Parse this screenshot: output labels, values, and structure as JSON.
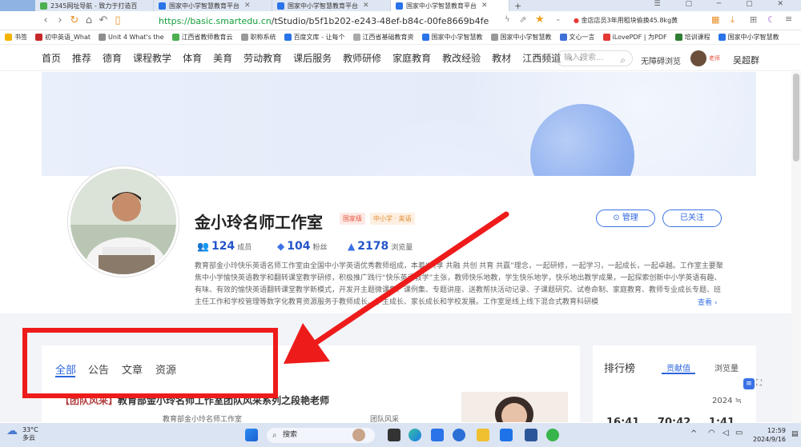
{
  "browser": {
    "tabs": [
      {
        "label": "2345网址导航 - 致力于打造百"
      },
      {
        "label": "国家中小学智慧教育平台"
      },
      {
        "label": "国家中小学智慧教育平台"
      },
      {
        "label": "国家中小学智慧教育平台"
      }
    ],
    "url_host": "https://basic.smartedu.cn",
    "url_path": "/tStudio/b5f1b202-e243-48ef-b84c-00fe8669b4fe",
    "ad_text": "金店店员3年用租块偷换45.8kg黄",
    "bookmarks": [
      "书签",
      "初中英语_What",
      "Unit 4 What's the",
      "江西省教师教育云",
      "职称系统",
      "百度文库 - 让每个",
      "江西省基础教育资",
      "国家中小学智慧教",
      "国家中小学智慧教",
      "文心一言",
      "iLovePDF | 为PDF",
      "培训课程",
      "国家中小学智慧教"
    ]
  },
  "site_nav": {
    "items": [
      "首页",
      "推荐",
      "德育",
      "课程教学",
      "体育",
      "美育",
      "劳动教育",
      "课后服务",
      "教师研修",
      "家庭教育",
      "教改经验",
      "教材",
      "江西频道"
    ],
    "search_placeholder": "输入搜索...",
    "accessibility": "无障碍浏览",
    "role_badge": "老师",
    "user_name": "吴超群"
  },
  "studio": {
    "title": "金小玲名师工作室",
    "tag_level": "国家级",
    "tag_subject": "中小学 · 英语",
    "manage_label": "管理",
    "follow_label": "已关注",
    "members_count": "124",
    "members_unit": "成员",
    "fans_count": "104",
    "fans_unit": "粉丝",
    "views_count": "2178",
    "views_unit": "浏览量",
    "description": "教育部金小玲快乐英语名师工作室由全国中小学英语优秀教师组成，本着“共享 共融 共创 共育 共赢”理念，一起研修，一起学习，一起成长，一起卓越。工作室主要聚焦中小学愉快英语教学和翻转课堂教学研修，积极推广践行“快乐英语教学”主张，教师快乐地教，学生快乐地学，快乐地出教学成果，一起探索创新中小学英语有趣、有味、有效的愉快英语翻转课堂教学新模式，开发开主题微课集、课例集、专题讲座、送教帮扶活动记录、子课题研究、试卷命制、家庭教育、教师专业成长专题、班主任工作和学校管理等数字化教育资源服务于教师成长、学生成长、家长成长和学校发展。工作室是线上线下混合式教育科研模",
    "more_label": "查看"
  },
  "content": {
    "tabs": [
      "全部",
      "公告",
      "文章",
      "资源"
    ],
    "article_title_bracket": "【团队风采】",
    "article_title": "教育部金小玲名师工作室团队风采系列之段艳老师",
    "article_author": "教育部金小玲名师工作室",
    "article_category": "团队风采"
  },
  "ranking": {
    "title": "排行榜",
    "tab_contribution": "贡献值",
    "tab_views": "浏览量",
    "year": "2024 ≒",
    "preview_numbers": "16:41 70:42 1:41"
  },
  "taskbar": {
    "temperature": "33°C",
    "weather": "多云",
    "search_label": "搜索",
    "time": "12:59",
    "date": "2024/9/16"
  },
  "colors": {
    "accent": "#2d66dd",
    "annotation_red": "#ee1b1b",
    "url_green": "#129e3a",
    "tag_level_bg": "#fde9e4",
    "tag_level_fg": "#e5533a",
    "tag_subject_bg": "#fdf0e2",
    "tag_subject_fg": "#e08a2d"
  }
}
